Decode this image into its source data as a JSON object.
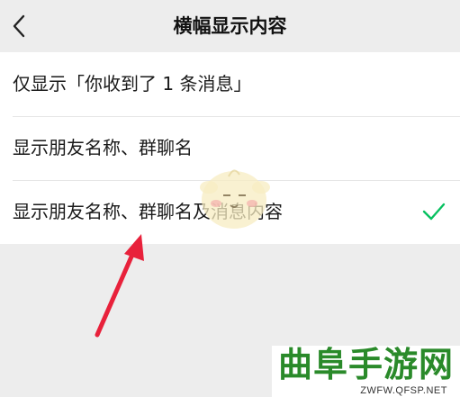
{
  "header": {
    "title": "横幅显示内容"
  },
  "options": [
    {
      "label": "仅显示「你收到了 1 条消息」",
      "selected": false
    },
    {
      "label": "显示朋友名称、群聊名",
      "selected": false
    },
    {
      "label": "显示朋友名称、群聊名及消息内容",
      "selected": true
    }
  ],
  "colors": {
    "accent": "#07c160",
    "arrow": "#e8213b",
    "watermark": "#2a8a2a"
  },
  "icons": {
    "back": "chevron-left-icon",
    "check": "checkmark-icon"
  },
  "watermark": {
    "main": "曲阜手游网",
    "sub": "ZWFW.QFSP.NET"
  }
}
